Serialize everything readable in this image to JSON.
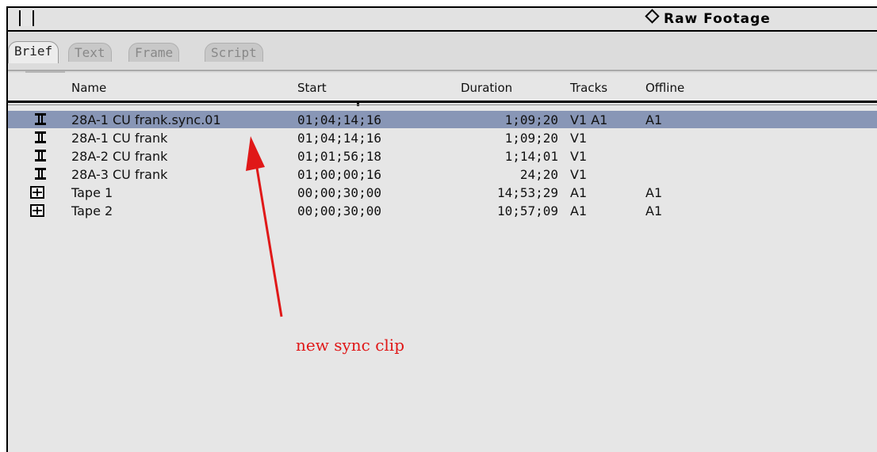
{
  "window": {
    "title": "Raw Footage"
  },
  "tabs": [
    {
      "label": "Brief"
    },
    {
      "label": "Text"
    },
    {
      "label": "Frame"
    },
    {
      "label": "Script"
    }
  ],
  "columns": {
    "name": "Name",
    "start": "Start",
    "duration": "Duration",
    "tracks": "Tracks",
    "offline": "Offline"
  },
  "rows": [
    {
      "icon": "clip-icon",
      "name": "28A-1 CU frank.sync.01",
      "start": "01;04;14;16",
      "duration": "1;09;20",
      "tracks": "V1 A1",
      "offline": "A1",
      "selected": true
    },
    {
      "icon": "clip-icon",
      "name": "28A-1 CU frank",
      "start": "01;04;14;16",
      "duration": "1;09;20",
      "tracks": "V1",
      "offline": ""
    },
    {
      "icon": "clip-icon",
      "name": "28A-2 CU frank",
      "start": "01;01;56;18",
      "duration": "1;14;01",
      "tracks": "V1",
      "offline": ""
    },
    {
      "icon": "clip-icon",
      "name": "28A-3 CU frank",
      "start": "01;00;00;16",
      "duration": "24;20",
      "tracks": "V1",
      "offline": ""
    },
    {
      "icon": "tape-icon",
      "name": "Tape 1",
      "start": "00;00;30;00",
      "duration": "14;53;29",
      "tracks": "A1",
      "offline": "A1"
    },
    {
      "icon": "tape-icon",
      "name": "Tape 2",
      "start": "00;00;30;00",
      "duration": "10;57;09",
      "tracks": "A1",
      "offline": "A1"
    }
  ],
  "annotation": {
    "text": "new sync clip"
  },
  "colors": {
    "selection": "#8896b6",
    "annotation": "#e01818",
    "panel": "#e6e6e6"
  }
}
